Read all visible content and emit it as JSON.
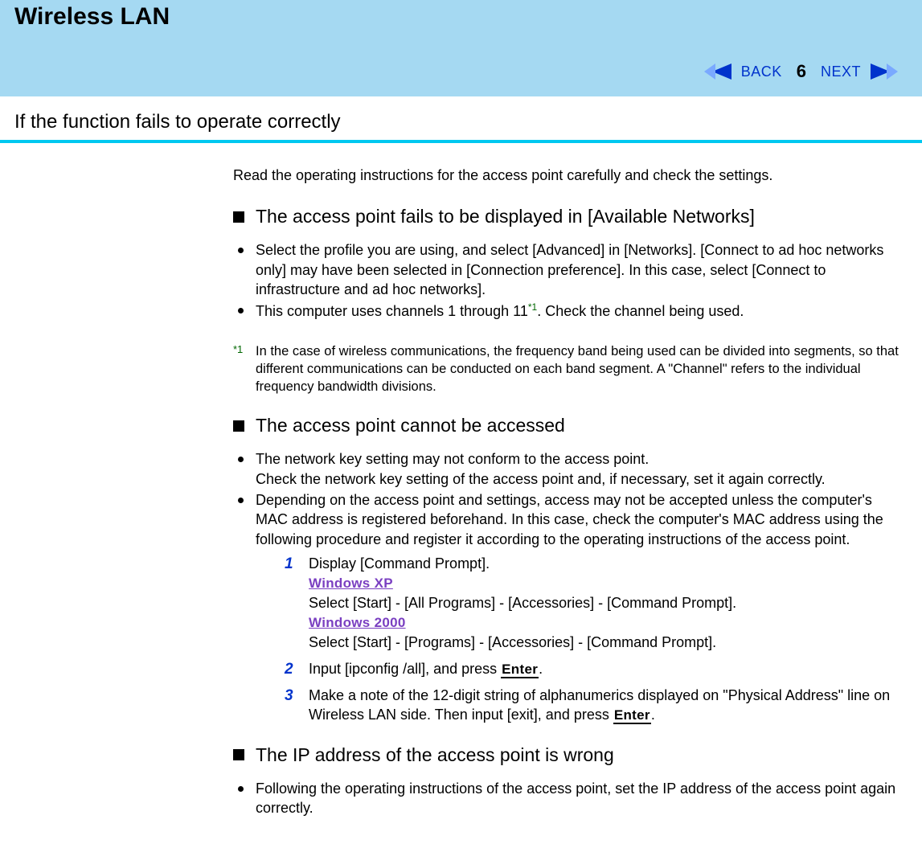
{
  "banner": {
    "title": "Wireless LAN",
    "back": "BACK",
    "next": "NEXT",
    "page": "6"
  },
  "subhead": "If the function fails to operate correctly",
  "intro": "Read the operating instructions for the access point carefully and check the settings.",
  "s1": {
    "heading": "The access point fails to be displayed in [Available Networks]",
    "b1": "Select the profile you are using, and select [Advanced] in [Networks].  [Connect to ad hoc networks only] may have been selected in [Connection preference].   In this case, select [Connect to infrastructure and ad hoc networks].",
    "b2a": "This computer uses channels 1 through 11",
    "b2sup": "*1",
    "b2b": ".  Check the channel being used.",
    "fn_marker": "*1",
    "fn": "In the case of wireless communications, the frequency band being used can be divided into segments, so that different communications can be conducted on each band segment.  A \"Channel\" refers to the individual frequency bandwidth divisions."
  },
  "s2": {
    "heading": "The access point cannot be accessed",
    "b1a": "The network key setting may not conform to the access point.",
    "b1b": "Check the network key setting of the access point and, if necessary, set it again correctly.",
    "b2": "Depending on the access point and settings, access may not be accepted unless the computer's MAC address is registered beforehand.   In this case, check the computer's MAC address using the following procedure and register it according to the operating instructions of the access point.",
    "step1_a": "Display [Command Prompt].",
    "step1_osxp": "Windows XP",
    "step1_xp": "Select [Start] - [All Programs] - [Accessories] - [Command Prompt].",
    "step1_os2000": "Windows 2000",
    "step1_2000": "Select [Start] - [Programs] - [Accessories] - [Command Prompt].",
    "step2_a": "Input [ipconfig /all], and press ",
    "step2_key": "Enter",
    "step2_b": ".",
    "step3_a": "Make a note of the 12-digit string of alphanumerics displayed on \"Physical Address\" line on Wireless LAN side.  Then input [exit], and press ",
    "step3_key": "Enter",
    "step3_b": ".",
    "n1": "1",
    "n2": "2",
    "n3": "3"
  },
  "s3": {
    "heading": "The IP address of the access point is wrong",
    "b1": "Following the operating instructions of the access point, set the IP address of the access point again correctly."
  }
}
